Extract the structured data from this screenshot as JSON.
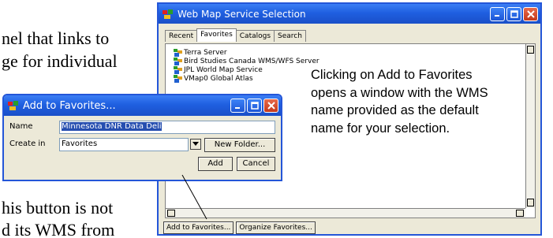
{
  "background_text": {
    "line1": "nel that links to",
    "line2": "ge for individual",
    "line3": "his button is not",
    "line4": "d its WMS from"
  },
  "wms_window": {
    "title": "Web Map Service Selection",
    "tabs": [
      "Recent",
      "Favorites",
      "Catalogs",
      "Search"
    ],
    "active_tab": "Favorites",
    "items": [
      "Terra Server",
      "Bird Studies Canada WMS/WFS Server",
      "JPL World Map Service",
      "VMap0 Global Atlas"
    ],
    "add_button": "Add to Favorites...",
    "organize_button": "Organize Favorites..."
  },
  "callout": {
    "text": "Clicking on Add to Favorites opens a window with the WMS name provided as the default name for your selection."
  },
  "favorites_dialog": {
    "title": "Add to Favorites...",
    "name_label": "Name",
    "name_value": "Minnesota DNR Data Deli",
    "create_in_label": "Create in",
    "create_in_value": "Favorites",
    "new_folder_button": "New Folder...",
    "add_button": "Add",
    "cancel_button": "Cancel"
  },
  "colors": {
    "titlebar": "#1f5fe0",
    "window_bg": "#ece9d8",
    "close_button": "#c4391a",
    "selection": "#264eb0"
  }
}
